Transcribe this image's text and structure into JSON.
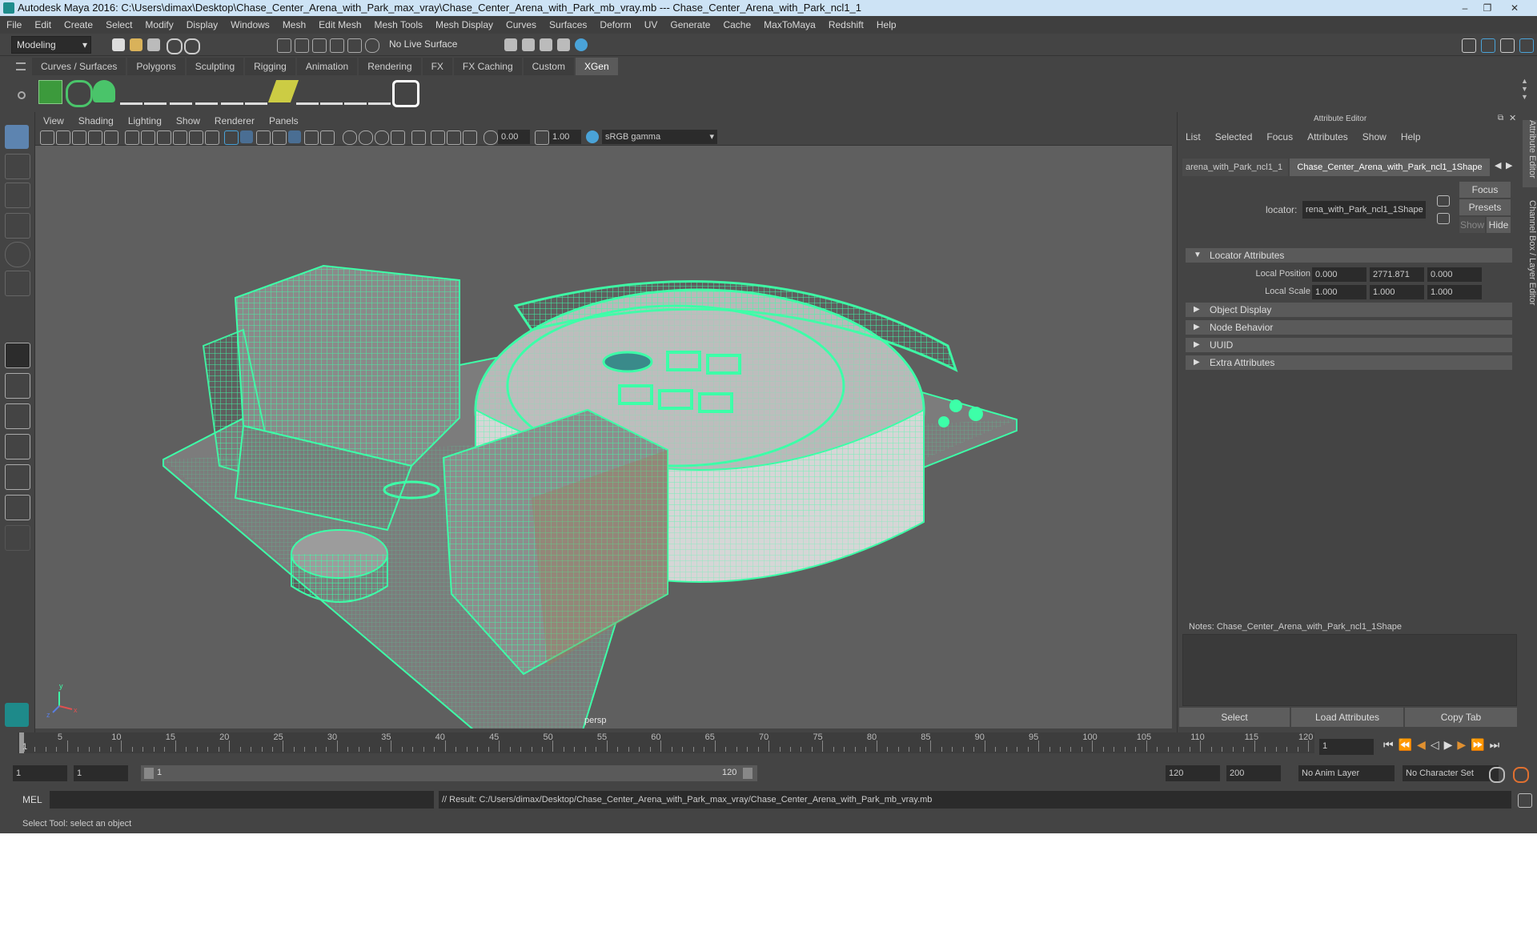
{
  "window": {
    "title": "Autodesk Maya 2016: C:\\Users\\dimax\\Desktop\\Chase_Center_Arena_with_Park_max_vray\\Chase_Center_Arena_with_Park_mb_vray.mb   ---   Chase_Center_Arena_with_Park_ncl1_1",
    "minimize": "‒",
    "maximize": "❐",
    "close": "✕"
  },
  "menubar": [
    "File",
    "Edit",
    "Create",
    "Select",
    "Modify",
    "Display",
    "Windows",
    "Mesh",
    "Edit Mesh",
    "Mesh Tools",
    "Mesh Display",
    "Curves",
    "Surfaces",
    "Deform",
    "UV",
    "Generate",
    "Cache",
    "MaxToMaya",
    "Redshift",
    "Help"
  ],
  "statusline": {
    "mode": "Modeling",
    "live_surface": "No Live Surface"
  },
  "shelf_tabs": [
    {
      "label": "Curves / Surfaces",
      "active": false
    },
    {
      "label": "Polygons",
      "active": false
    },
    {
      "label": "Sculpting",
      "active": false
    },
    {
      "label": "Rigging",
      "active": false
    },
    {
      "label": "Animation",
      "active": false
    },
    {
      "label": "Rendering",
      "active": false
    },
    {
      "label": "FX",
      "active": false
    },
    {
      "label": "FX Caching",
      "active": false
    },
    {
      "label": "Custom",
      "active": false
    },
    {
      "label": "XGen",
      "active": true
    }
  ],
  "viewport": {
    "menus": [
      "View",
      "Shading",
      "Lighting",
      "Show",
      "Renderer",
      "Panels"
    ],
    "exposure": "0.00",
    "gamma": "1.00",
    "color_space": "sRGB gamma",
    "camera_label": "persp",
    "wire_color": "#3dffa8"
  },
  "attribute_editor": {
    "title": "Attribute Editor",
    "menus": [
      "List",
      "Selected",
      "Focus",
      "Attributes",
      "Show",
      "Help"
    ],
    "tabs": [
      {
        "label": "arena_with_Park_ncl1_1",
        "active": false
      },
      {
        "label": "Chase_Center_Arena_with_Park_ncl1_1Shape",
        "active": true
      }
    ],
    "locator_label": "locator:",
    "locator_value": "rena_with_Park_ncl1_1Shape",
    "focus": "Focus",
    "presets": "Presets",
    "show": "Show",
    "hide": "Hide",
    "sections": [
      {
        "label": "Locator Attributes",
        "expanded": true
      },
      {
        "label": "Object Display",
        "expanded": false
      },
      {
        "label": "Node Behavior",
        "expanded": false
      },
      {
        "label": "UUID",
        "expanded": false
      },
      {
        "label": "Extra Attributes",
        "expanded": false
      }
    ],
    "local_position": {
      "label": "Local Position",
      "values": [
        "0.000",
        "2771.871",
        "0.000"
      ]
    },
    "local_scale": {
      "label": "Local Scale",
      "values": [
        "1.000",
        "1.000",
        "1.000"
      ]
    },
    "notes_label": "Notes:  Chase_Center_Arena_with_Park_ncl1_1Shape",
    "buttons": [
      "Select",
      "Load Attributes",
      "Copy Tab"
    ],
    "side_tabs": [
      "Attribute Editor",
      "Channel Box / Layer Editor"
    ]
  },
  "timeline": {
    "ticks": [
      "5",
      "10",
      "15",
      "20",
      "25",
      "30",
      "35",
      "40",
      "45",
      "50",
      "55",
      "60",
      "65",
      "70",
      "75",
      "80",
      "85",
      "90",
      "95",
      "100",
      "105",
      "110",
      "115",
      "120"
    ],
    "start_label": "1",
    "current_frame": "1"
  },
  "range": {
    "start": "1",
    "playback_start": "1",
    "slider_start": "1",
    "slider_end": "120",
    "playback_end": "120",
    "end": "200",
    "anim_layer": "No Anim Layer",
    "character_set": "No Character Set"
  },
  "command": {
    "language": "MEL",
    "result": "// Result: C:/Users/dimax/Desktop/Chase_Center_Arena_with_Park_max_vray/Chase_Center_Arena_with_Park_mb_vray.mb"
  },
  "help_line": "Select Tool: select an object"
}
